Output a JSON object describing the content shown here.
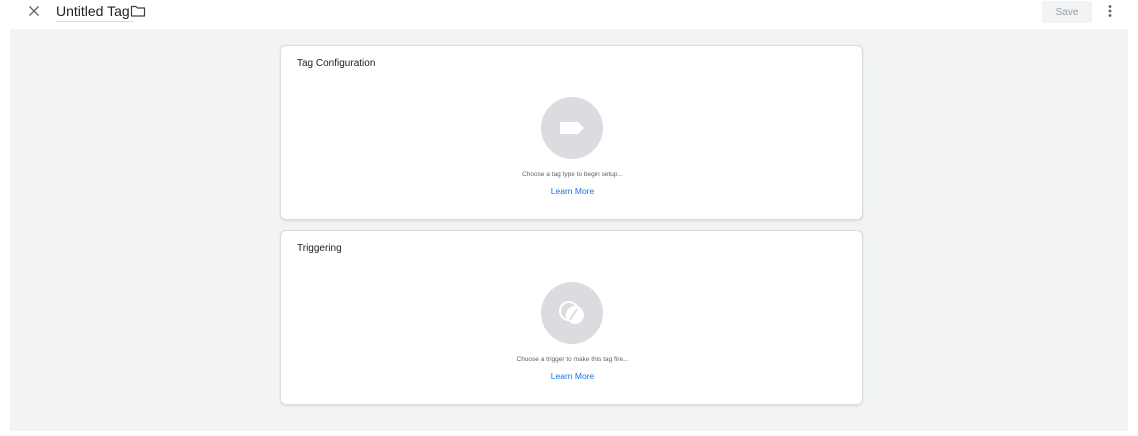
{
  "header": {
    "tag_name": "Untitled Tag",
    "save_label": "Save"
  },
  "tag_configuration": {
    "title": "Tag Configuration",
    "hint": "Choose a tag type to begin setup...",
    "learn_more": "Learn More"
  },
  "triggering": {
    "title": "Triggering",
    "hint": "Choose a trigger to make this tag fire...",
    "learn_more": "Learn More"
  },
  "colors": {
    "accent": "#1a73e8",
    "workspace_bg": "#f1f3f4",
    "icon_circle": "#dadce0"
  },
  "icons": [
    "close-icon",
    "folder-icon",
    "more-vert-icon",
    "tag-icon",
    "trigger-icon"
  ]
}
